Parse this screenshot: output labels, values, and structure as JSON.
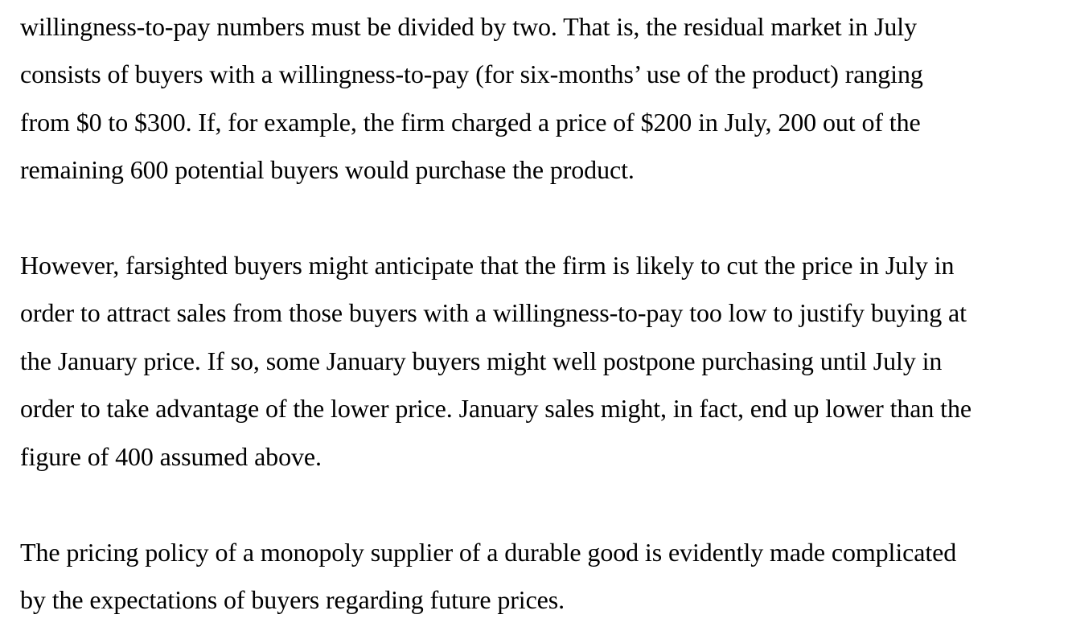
{
  "document": {
    "paragraphs": [
      {
        "lines": [
          "willingness-to-pay numbers must be divided by two. That is, the residual market in July",
          "consists of buyers with a willingness-to-pay (for six-months’ use of the product) ranging",
          "from $0 to $300. If, for example, the firm charged a price of $200 in July, 200 out of the",
          "remaining 600 potential buyers would purchase the product."
        ]
      },
      {
        "lines": [
          "However, farsighted buyers might anticipate that the firm is likely to cut the price in July in",
          "order to attract sales from those buyers with a willingness-to-pay too low to justify buying at",
          "the January price. If so, some January buyers might well postpone purchasing until July in",
          "order to take advantage of the lower price. January sales might, in fact, end up lower than the",
          "figure of 400 assumed above."
        ]
      },
      {
        "lines": [
          "The pricing policy of a monopoly supplier of a durable good is evidently made complicated",
          "by the expectations of buyers regarding future prices."
        ]
      }
    ]
  }
}
